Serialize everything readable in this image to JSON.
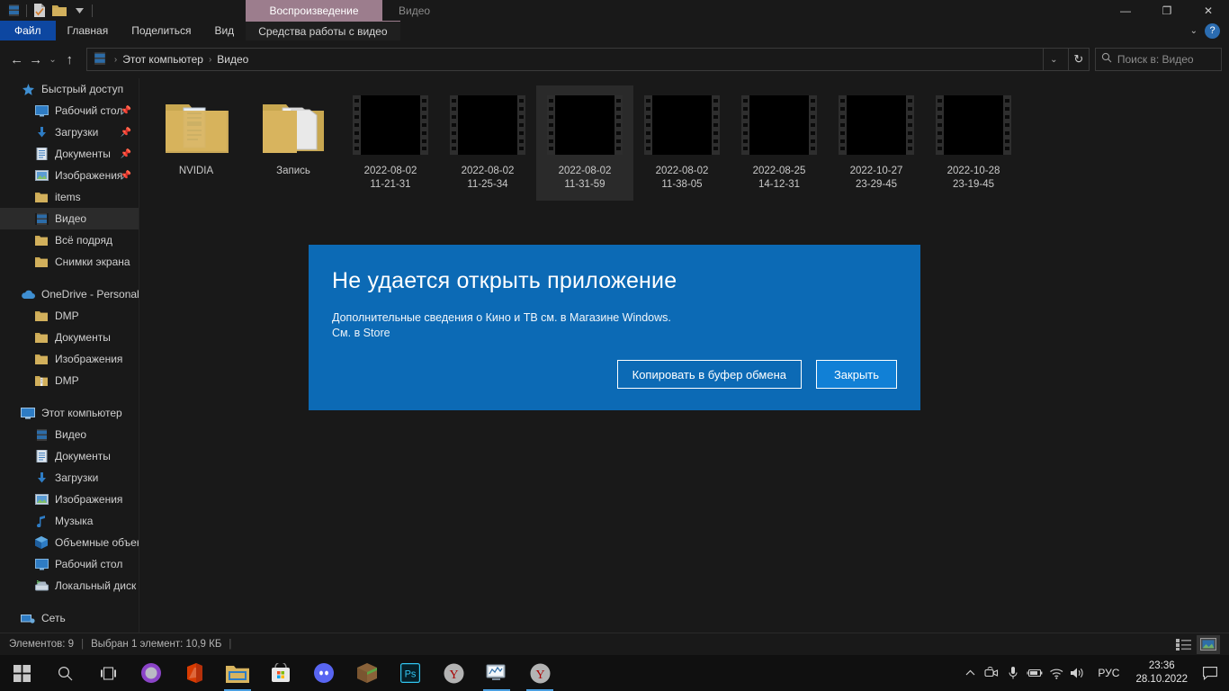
{
  "window": {
    "contextual_tab": "Воспроизведение",
    "title": "Видео",
    "minimize": "—",
    "restore": "❐",
    "close": "✕",
    "collapse_chevron": "⌄",
    "help": "?"
  },
  "quick_access_toolbar": [
    {
      "name": "video-library-icon"
    },
    {
      "name": "properties-icon"
    },
    {
      "name": "new-folder-icon"
    },
    {
      "name": "customize-chevron-icon"
    }
  ],
  "ribbon": {
    "tabs": [
      {
        "label": "Файл",
        "active_style": "file"
      },
      {
        "label": "Главная",
        "active_style": "normal"
      },
      {
        "label": "Поделиться",
        "active_style": "normal"
      },
      {
        "label": "Вид",
        "active_style": "normal"
      },
      {
        "label": "Средства работы с видео",
        "active_style": "contextual"
      }
    ]
  },
  "address_bar": {
    "back": "←",
    "forward": "→",
    "recent": "⌄",
    "up": "↑",
    "breadcrumbs": [
      "Этот компьютер",
      "Видео"
    ],
    "separator": "›",
    "dropdown_chevron": "⌄",
    "refresh": "↻",
    "search_placeholder": "Поиск в: Видео",
    "search_value": ""
  },
  "sidebar": {
    "groups": [
      {
        "header": {
          "label": "Быстрый доступ",
          "icon": "star-icon"
        },
        "items": [
          {
            "label": "Рабочий стол",
            "icon": "desktop-icon",
            "pinned": true
          },
          {
            "label": "Загрузки",
            "icon": "downloads-icon",
            "pinned": true
          },
          {
            "label": "Документы",
            "icon": "documents-icon",
            "pinned": true
          },
          {
            "label": "Изображения",
            "icon": "pictures-icon",
            "pinned": true
          },
          {
            "label": "items",
            "icon": "folder-icon",
            "pinned": false
          },
          {
            "label": "Видео",
            "icon": "video-folder-icon",
            "pinned": false,
            "selected": true
          },
          {
            "label": "Всё подряд",
            "icon": "folder-icon",
            "pinned": false
          },
          {
            "label": "Снимки экрана",
            "icon": "folder-icon",
            "pinned": false
          }
        ]
      },
      {
        "header": {
          "label": "OneDrive - Personal",
          "icon": "onedrive-icon"
        },
        "items": [
          {
            "label": "DMP",
            "icon": "folder-icon"
          },
          {
            "label": "Документы",
            "icon": "folder-icon"
          },
          {
            "label": "Изображения",
            "icon": "folder-icon"
          },
          {
            "label": "DMP",
            "icon": "zip-folder-icon"
          }
        ]
      },
      {
        "header": {
          "label": "Этот компьютер",
          "icon": "this-pc-icon"
        },
        "items": [
          {
            "label": "Видео",
            "icon": "video-folder-icon"
          },
          {
            "label": "Документы",
            "icon": "documents-icon"
          },
          {
            "label": "Загрузки",
            "icon": "downloads-icon"
          },
          {
            "label": "Изображения",
            "icon": "pictures-icon"
          },
          {
            "label": "Музыка",
            "icon": "music-icon"
          },
          {
            "label": "Объемные объект",
            "icon": "3d-objects-icon"
          },
          {
            "label": "Рабочий стол",
            "icon": "desktop-icon"
          },
          {
            "label": "Локальный диск ((",
            "icon": "drive-icon"
          }
        ]
      },
      {
        "header": {
          "label": "Сеть",
          "icon": "network-icon"
        },
        "items": []
      }
    ]
  },
  "files": [
    {
      "name": "NVIDIA",
      "type": "folder",
      "selected": false
    },
    {
      "name": "Запись",
      "type": "folder",
      "selected": false
    },
    {
      "name": "2022-08-02\n11-21-31",
      "line1": "2022-08-02",
      "line2": "11-21-31",
      "type": "video",
      "selected": false
    },
    {
      "name": "2022-08-02\n11-25-34",
      "line1": "2022-08-02",
      "line2": "11-25-34",
      "type": "video",
      "selected": false
    },
    {
      "name": "2022-08-02\n11-31-59",
      "line1": "2022-08-02",
      "line2": "11-31-59",
      "type": "video",
      "selected": true
    },
    {
      "name": "2022-08-02\n11-38-05",
      "line1": "2022-08-02",
      "line2": "11-38-05",
      "type": "video",
      "selected": false
    },
    {
      "name": "2022-08-25\n14-12-31",
      "line1": "2022-08-25",
      "line2": "14-12-31",
      "type": "video",
      "selected": false
    },
    {
      "name": "2022-10-27\n23-29-45",
      "line1": "2022-10-27",
      "line2": "23-29-45",
      "type": "video",
      "selected": false
    },
    {
      "name": "2022-10-28\n23-19-45",
      "line1": "2022-10-28",
      "line2": "23-19-45",
      "type": "video",
      "selected": false
    }
  ],
  "dialog": {
    "title": "Не удается открыть приложение",
    "body": "Дополнительные сведения о Кино и ТВ см. в Магазине Windows.",
    "link": "См. в Store",
    "copy_button": "Копировать в буфер обмена",
    "close_button": "Закрыть",
    "accent_color": "#0c6ab5"
  },
  "status_bar": {
    "items_count": "Элементов: 9",
    "separator": "|",
    "selection": "Выбран 1 элемент: 10,9 КБ",
    "trailing_separator": "|",
    "view_details": "details-view-icon",
    "view_large_icons": "large-icons-view-icon"
  },
  "taskbar": {
    "start": "start-icon",
    "search": "search-icon",
    "task_view": "task-view-icon",
    "pinned": [
      {
        "name": "cortana-icon",
        "running": false
      },
      {
        "name": "office-icon",
        "running": false
      },
      {
        "name": "file-explorer-icon",
        "running": true
      },
      {
        "name": "microsoft-store-icon",
        "running": false
      },
      {
        "name": "discord-icon",
        "running": false
      },
      {
        "name": "minecraft-icon",
        "running": false
      },
      {
        "name": "photoshop-icon",
        "running": false
      },
      {
        "name": "yandex-browser-icon",
        "running": false
      },
      {
        "name": "task-manager-icon",
        "running": true
      },
      {
        "name": "yandex-browser-2-icon",
        "running": true
      }
    ],
    "tray": [
      {
        "name": "tray-expand-chevron-icon"
      },
      {
        "name": "camera-icon"
      },
      {
        "name": "microphone-icon"
      },
      {
        "name": "battery-icon"
      },
      {
        "name": "wifi-icon"
      },
      {
        "name": "volume-icon"
      }
    ],
    "language": "РУС",
    "time": "23:36",
    "date": "28.10.2022",
    "notifications": "notification-icon"
  }
}
